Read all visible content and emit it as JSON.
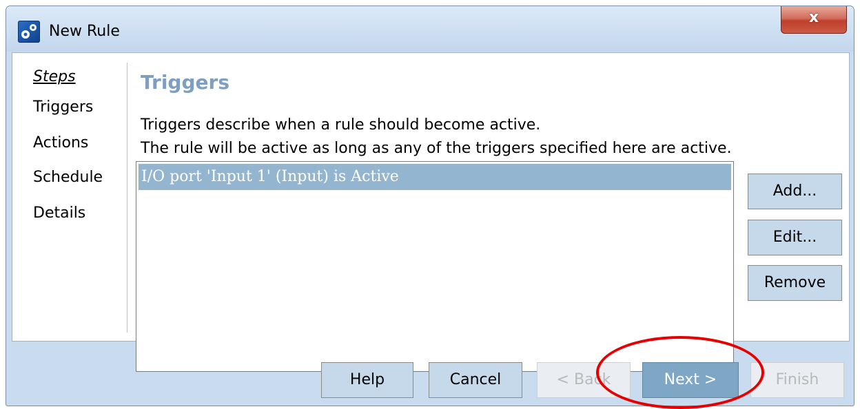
{
  "window": {
    "title": "New Rule",
    "close_label": "x"
  },
  "steps": {
    "header": "Steps",
    "items": [
      "Triggers",
      "Actions",
      "Schedule",
      "Details"
    ]
  },
  "page": {
    "heading": "Triggers",
    "description_line1": "Triggers describe when a rule should become active.",
    "description_line2": "The rule will be active as long as any of the triggers specified here are active."
  },
  "triggers_list": {
    "items": [
      "I/O port 'Input 1' (Input) is Active"
    ],
    "selected_index": 0
  },
  "side_buttons": {
    "add": "Add...",
    "edit": "Edit...",
    "remove": "Remove"
  },
  "footer_buttons": {
    "help": "Help",
    "cancel": "Cancel",
    "back": "< Back",
    "next": "Next >",
    "finish": "Finish"
  },
  "colors": {
    "heading": "#7f9fc0",
    "selection": "#94b5cf",
    "annotation": "#e60000"
  },
  "icons": {
    "app": "settings-gears-icon",
    "close": "close-icon"
  }
}
